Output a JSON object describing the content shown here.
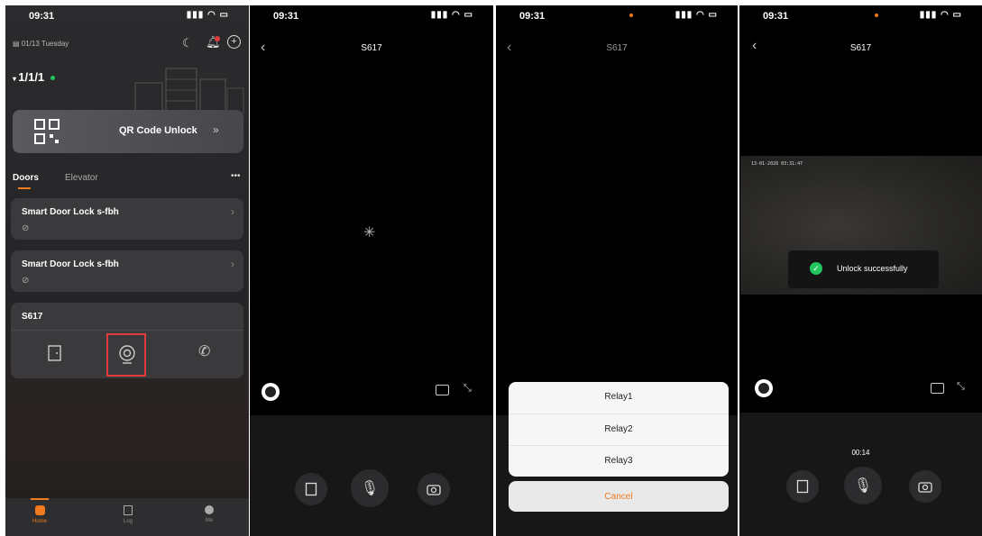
{
  "status_bar": {
    "time": "09:31"
  },
  "home": {
    "date": "01/13 Tuesday",
    "site": "1/1/1",
    "qr_label": "QR Code Unlock",
    "tabs": [
      "Doors",
      "Elevator"
    ],
    "more": "•••",
    "doors": [
      {
        "name": "Smart Door Lock s-fbh"
      },
      {
        "name": "Smart Door Lock s-fbh"
      }
    ],
    "device": {
      "name": "S617"
    },
    "nav": [
      "Home",
      "Log",
      "Me"
    ]
  },
  "call": {
    "title": "S617"
  },
  "relay_sheet": {
    "items": [
      "Relay1",
      "Relay2",
      "Relay3"
    ],
    "cancel": "Cancel"
  },
  "result": {
    "title": "S617",
    "timestamp": "13-01-2026 03:31:47",
    "toast": "Unlock successfully",
    "timer": "00:14"
  },
  "colors": {
    "accent": "#f07a1e",
    "success": "#22c55e",
    "highlight": "#e23b3b"
  }
}
